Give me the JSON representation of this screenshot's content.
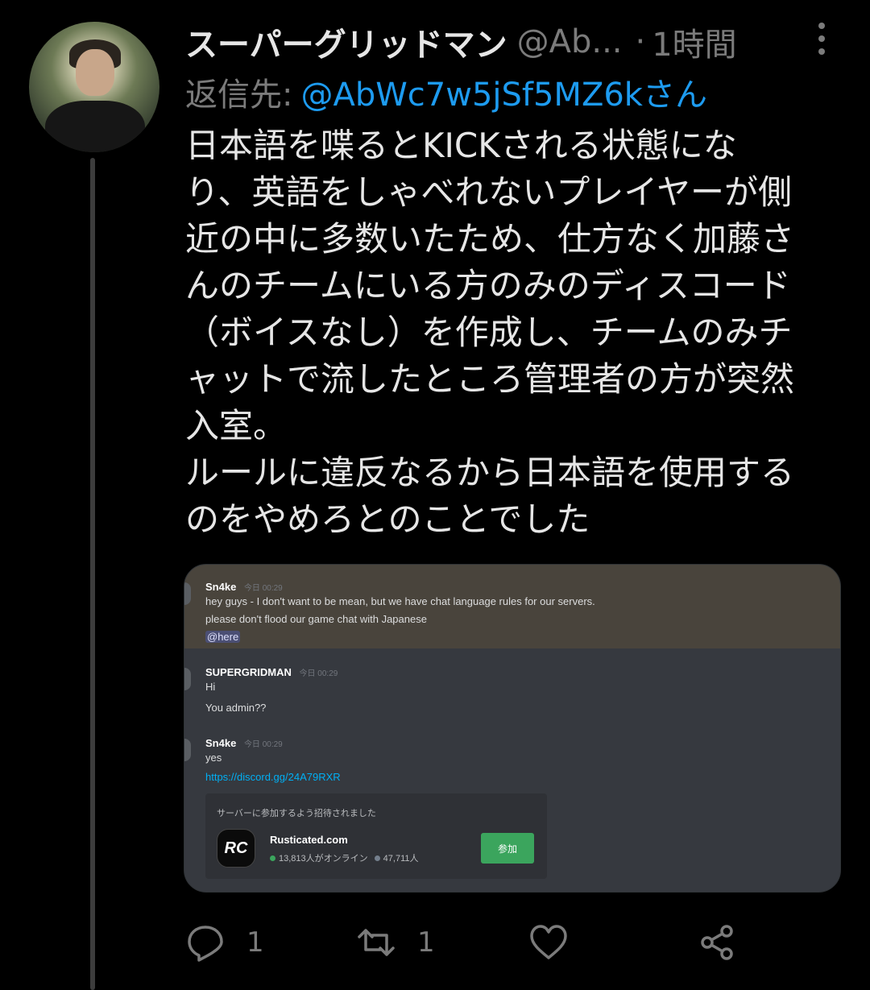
{
  "tweet": {
    "display_name": "スーパーグリッドマン",
    "handle": "@Ab...",
    "separator": "·",
    "time": "1時間",
    "reply_label": "返信先:",
    "reply_target": "@AbWc7w5jSf5MZ6kさん",
    "body_lines": [
      "日本語を喋るとKICKされる状態にな",
      "り、英語をしゃべれないプレイヤーが側",
      "近の中に多数いたため、仕方なく加藤さ",
      "んのチームにいる方のみのディスコード",
      "（ボイスなし）を作成し、チームのみチ",
      "ャットで流したところ管理者の方が突然",
      "入室。",
      "ルールに違反なるから日本語を使用する",
      "のをやめろとのことでした"
    ]
  },
  "discord": {
    "messages": [
      {
        "author": "Sn4ke",
        "time": "今日 00:29",
        "lines": [
          "hey guys - I don't want to be mean, but we have chat language rules for our servers.",
          "please don't flood our game chat with Japanese"
        ],
        "mention": "@here"
      },
      {
        "author": "SUPERGRIDMAN",
        "time": "今日 00:29",
        "lines": [
          "Hi",
          "You admin??"
        ]
      },
      {
        "author": "Sn4ke",
        "time": "今日 00:29",
        "lines": [
          "yes"
        ],
        "link": "https://discord.gg/24A79RXR"
      }
    ],
    "invite": {
      "title": "サーバーに参加するよう招待されました",
      "logo_text": "RC",
      "server_name": "Rusticated.com",
      "online": "13,813人がオンライン",
      "members": "47,711人",
      "join_label": "参加"
    }
  },
  "actions": {
    "reply_count": "1",
    "retweet_count": "1",
    "like_count": "",
    "icons": [
      "reply-icon",
      "retweet-icon",
      "like-icon",
      "share-icon"
    ]
  },
  "colors": {
    "background": "#000000",
    "link": "#1d9bf0",
    "muted": "#7b7b7b",
    "discord_bg": "#36393f",
    "discord_highlight": "#49443c",
    "join_button": "#3ba55d"
  }
}
